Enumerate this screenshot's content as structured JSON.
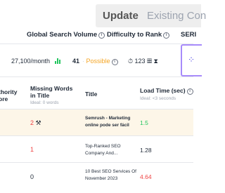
{
  "update_button": {
    "update": "Update",
    "existing": "Existing Con"
  },
  "metrics_header": {
    "global_search_volume": "Global Search Volume",
    "difficulty_to_rank": "Difficulty to Rank",
    "serp": "SERI"
  },
  "metrics": {
    "volume": "27,100/month",
    "difficulty_score": "41",
    "difficulty_label": "Possible",
    "serp_stat": "123"
  },
  "table": {
    "headers": {
      "authority": "thority\nore",
      "missing_words": "Missing Words\nin Title",
      "missing_words_ideal": "Ideal: 0 words",
      "title": "Title",
      "load_time": "Load Time (sec)",
      "load_time_ideal": "Ideal: <3 seconds"
    },
    "rows": [
      {
        "missing": "2",
        "title": "Semrush - Marketing online pode ser fácil",
        "load_time": "1.5"
      },
      {
        "missing": "1",
        "title": "Top-Ranked SEO Company And...",
        "load_time": "1.28"
      },
      {
        "missing": "0",
        "title": "10 Best SEO Services Of November 2023",
        "load_time": "4.64"
      }
    ]
  },
  "colors": {
    "accent_purple": "#a78bfa",
    "possible_orange": "#f5a524",
    "good_green": "#22c55e",
    "bad_red": "#ef4444",
    "highlight_row": "#fdf6e8"
  }
}
